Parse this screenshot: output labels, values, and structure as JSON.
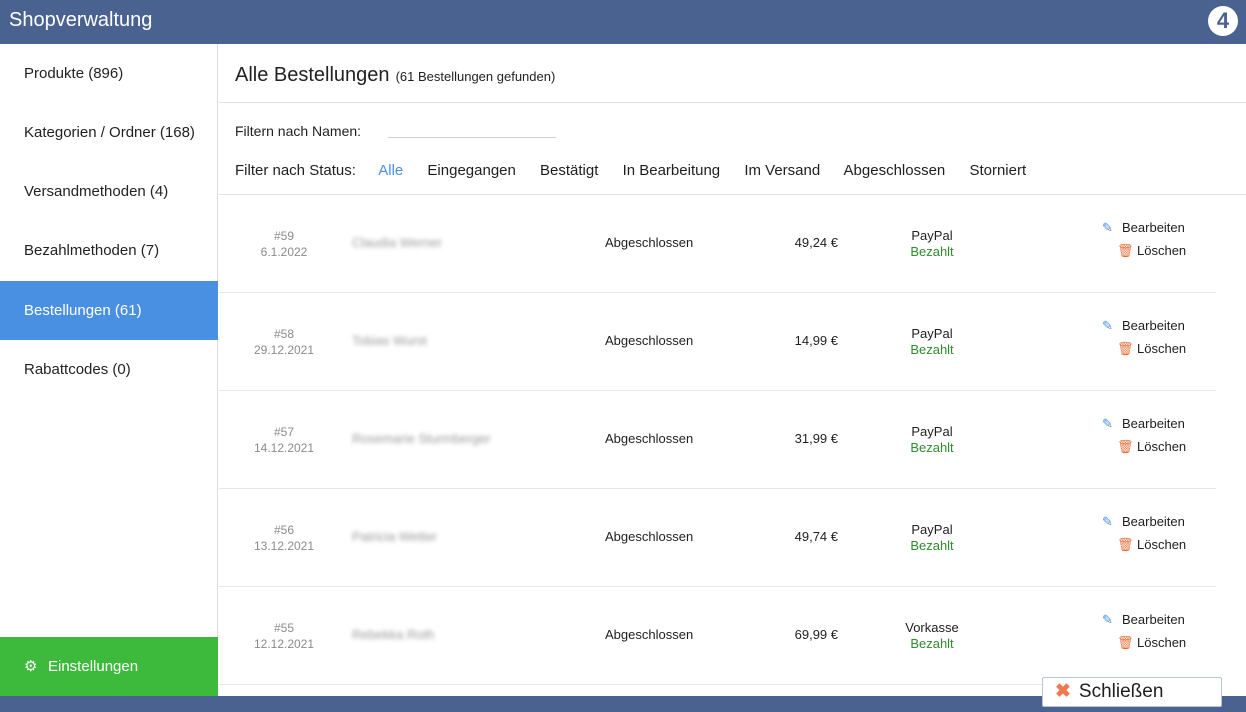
{
  "app": {
    "title": "Shopverwaltung",
    "logo": "4"
  },
  "sidebar": {
    "items": [
      {
        "label": "Produkte (896)"
      },
      {
        "label": "Kategorien / Ordner (168)"
      },
      {
        "label": "Versandmethoden (4)"
      },
      {
        "label": "Bezahlmethoden (7)"
      },
      {
        "label": "Bestellungen (61)",
        "active": true
      },
      {
        "label": "Rabattcodes (0)"
      }
    ],
    "settings": {
      "label": "Einstellungen",
      "icon": "gear-icon"
    }
  },
  "main": {
    "title": "Alle Bestellungen",
    "count": "(61 Bestellungen gefunden)",
    "filter_name_label": "Filtern nach Namen:",
    "filter_name_value": "",
    "filter_status_label": "Filter nach Status:",
    "status_options": [
      "Alle",
      "Eingegangen",
      "Bestätigt",
      "In Bearbeitung",
      "Im Versand",
      "Abgeschlossen",
      "Storniert"
    ],
    "selected_status": "Alle",
    "accent_color": "#4a90e2"
  },
  "orders": [
    {
      "number": "#59",
      "date": "6.1.2022",
      "name": "Claudia Werner",
      "status": "Abgeschlossen",
      "price": "49,24 €",
      "payment": "PayPal",
      "payment_status": "Bezahlt"
    },
    {
      "number": "#58",
      "date": "29.12.2021",
      "name": "Tobias Wurst",
      "status": "Abgeschlossen",
      "price": "14,99 €",
      "payment": "PayPal",
      "payment_status": "Bezahlt"
    },
    {
      "number": "#57",
      "date": "14.12.2021",
      "name": "Rosemarie Sturmberger",
      "status": "Abgeschlossen",
      "price": "31,99 €",
      "payment": "PayPal",
      "payment_status": "Bezahlt"
    },
    {
      "number": "#56",
      "date": "13.12.2021",
      "name": "Patricia Wetter",
      "status": "Abgeschlossen",
      "price": "49,74 €",
      "payment": "PayPal",
      "payment_status": "Bezahlt"
    },
    {
      "number": "#55",
      "date": "12.12.2021",
      "name": "Rebekka Roth",
      "status": "Abgeschlossen",
      "price": "69,99 €",
      "payment": "Vorkasse",
      "payment_status": "Bezahlt"
    }
  ],
  "actions": {
    "edit": "Bearbeiten",
    "delete": "Löschen"
  },
  "close_button": {
    "label": "Schließen"
  }
}
